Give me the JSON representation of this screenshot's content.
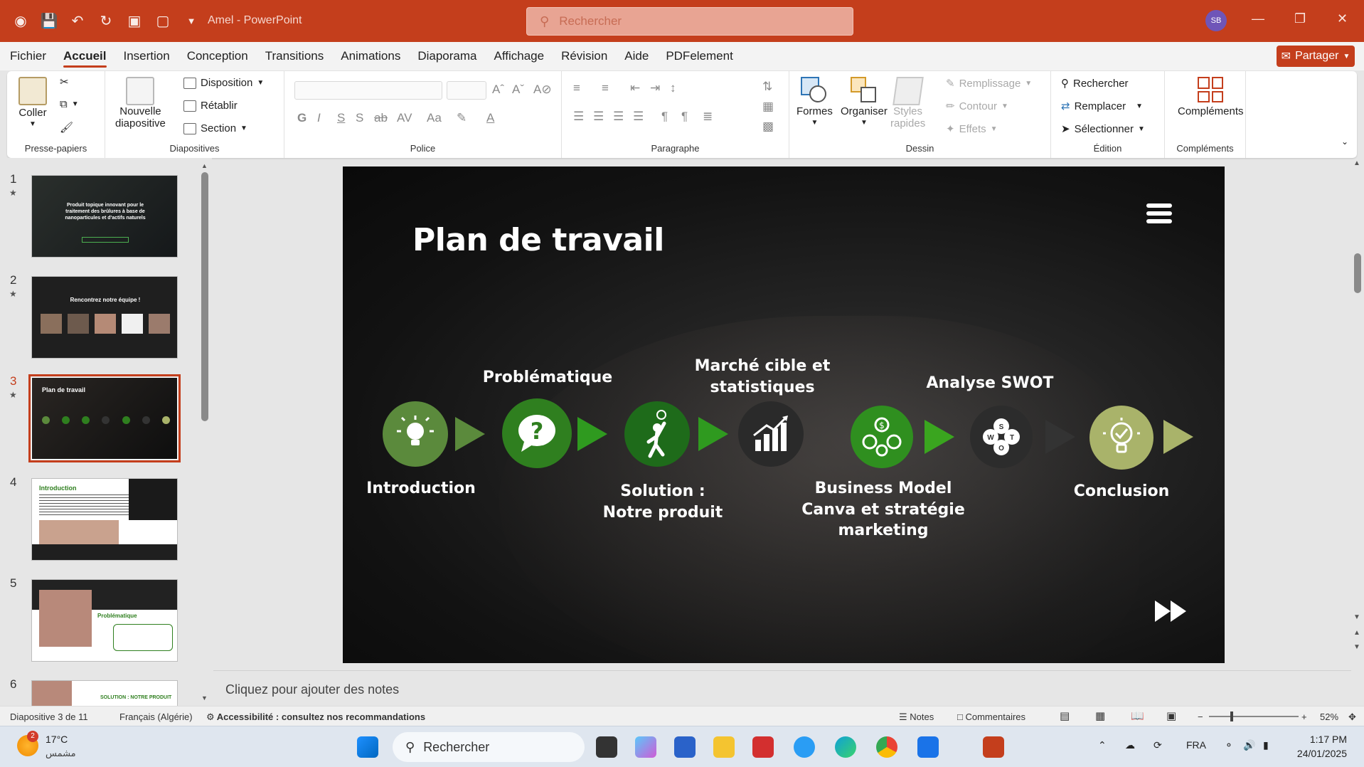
{
  "app": {
    "title": "Amel  -  PowerPoint",
    "search_placeholder": "Rechercher",
    "user_initials": "SB",
    "accent": "#c43e1c"
  },
  "menu": {
    "tabs": [
      "Fichier",
      "Accueil",
      "Insertion",
      "Conception",
      "Transitions",
      "Animations",
      "Diaporama",
      "Affichage",
      "Révision",
      "Aide",
      "PDFelement"
    ],
    "active": "Accueil",
    "share_label": "Partager"
  },
  "ribbon": {
    "clipboard": {
      "paste": "Coller",
      "group": "Presse-papiers"
    },
    "slides": {
      "new_slide_1": "Nouvelle",
      "new_slide_2": "diapositive",
      "layout": "Disposition",
      "reset": "Rétablir",
      "section": "Section",
      "group": "Diapositives"
    },
    "font": {
      "group": "Police"
    },
    "paragraph": {
      "group": "Paragraphe"
    },
    "drawing": {
      "shapes": "Formes",
      "arrange": "Organiser",
      "quick_styles_1": "Styles",
      "quick_styles_2": "rapides",
      "fill": "Remplissage",
      "outline": "Contour",
      "effects": "Effets",
      "group": "Dessin"
    },
    "editing": {
      "find": "Rechercher",
      "replace": "Remplacer",
      "select": "Sélectionner",
      "group": "Édition"
    },
    "addins": {
      "label": "Compléments",
      "group": "Compléments"
    }
  },
  "thumbnails": [
    {
      "num": "1",
      "caption": "Produit topique innovant pour le traitement des brûlures à base de nanoparticules et d'actifs naturels"
    },
    {
      "num": "2",
      "caption": "Rencontrez notre équipe !"
    },
    {
      "num": "3",
      "caption": "Plan de travail"
    },
    {
      "num": "4",
      "caption": "Introduction"
    },
    {
      "num": "5",
      "caption": "Problématique"
    },
    {
      "num": "6",
      "caption": "SOLUTION : NOTRE PRODUIT"
    }
  ],
  "slide": {
    "title": "Plan de travail",
    "steps": {
      "introduction": "Introduction",
      "problematique": "Problématique",
      "solution_1": "Solution :",
      "solution_2": "Notre produit",
      "marche_1": "Marché cible et",
      "marche_2": "statistiques",
      "business_1": "Business Model",
      "business_2": "Canva et stratégie",
      "business_3": "marketing",
      "swot": "Analyse SWOT",
      "conclusion": "Conclusion"
    },
    "colors": {
      "green_dark": "#5b8a3c",
      "green_mid": "#2f7f1f",
      "green_arrow": "#4c8f2e",
      "olive": "#a9b36a",
      "dark_circle": "#2f2f2f"
    }
  },
  "notes_placeholder": "Cliquez pour ajouter des notes",
  "status": {
    "slide_count": "Diapositive 3 de 11",
    "language": "Français (Algérie)",
    "accessibility": "Accessibilité : consultez nos recommandations",
    "notes": "Notes",
    "comments": "Commentaires",
    "zoom": "52%"
  },
  "taskbar": {
    "weather_temp": "17°C",
    "weather_desc": "مشمس",
    "weather_badge": "2",
    "search": "Rechercher",
    "lang": "FRA",
    "time": "1:17 PM",
    "date": "24/01/2025"
  }
}
